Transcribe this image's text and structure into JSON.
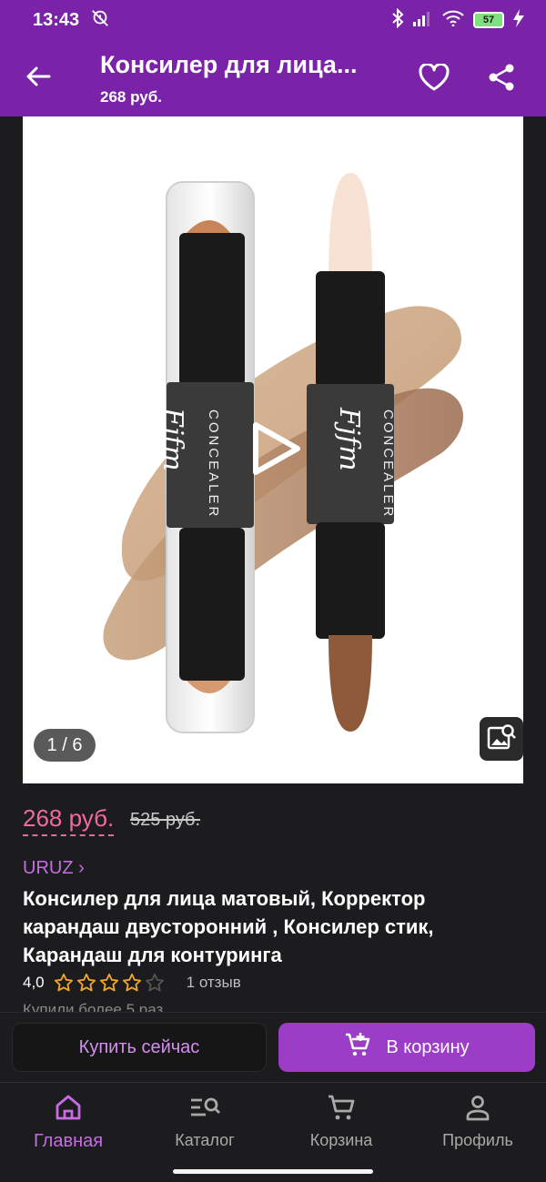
{
  "status": {
    "time": "13:43",
    "battery": "57"
  },
  "appbar": {
    "title": "Консилер для лица...",
    "subtitle": "268 руб."
  },
  "gallery": {
    "counter": "1 / 6",
    "brand_text": "CONCEALER",
    "logo_text": "Fjfm"
  },
  "product": {
    "price": "268 руб.",
    "old_price": "525 руб.",
    "brand": "URUZ ›",
    "title": "Консилер для лица матовый, Корректор карандаш двусторонний , Консилер стик, Карандаш для контуринга",
    "rating": "4,0",
    "rating_value": 4,
    "rating_max": 5,
    "reviews": "1 отзыв",
    "bought": "Купили более 5 раз"
  },
  "actions": {
    "buy_now": "Купить сейчас",
    "add_to_cart": "В корзину"
  },
  "nav": [
    {
      "label": "Главная",
      "icon": "home-icon",
      "active": true
    },
    {
      "label": "Каталог",
      "icon": "catalog-search-icon",
      "active": false
    },
    {
      "label": "Корзина",
      "icon": "cart-icon",
      "active": false
    },
    {
      "label": "Профиль",
      "icon": "profile-icon",
      "active": false
    }
  ],
  "colors": {
    "accent": "#7a22a8",
    "price": "#f06a9a",
    "brand": "#c66de6",
    "cart_button": "#9b3dc6",
    "star": "#f5a623"
  }
}
